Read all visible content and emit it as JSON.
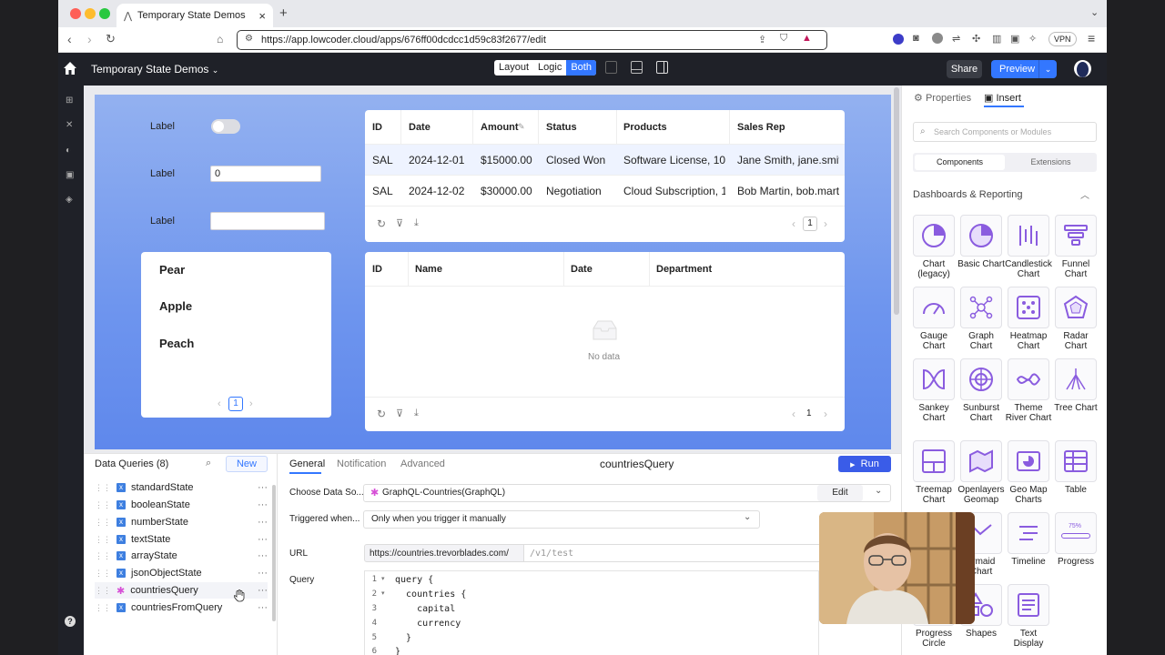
{
  "browser": {
    "tab_title": "Temporary State Demos",
    "url": "https://app.lowcoder.cloud/apps/676ff00dcdcc1d59c83f2677/edit",
    "vpn": "VPN"
  },
  "header": {
    "app_title": "Temporary State Demos",
    "modes": [
      "Layout",
      "Logic",
      "Both"
    ],
    "active_mode": "Both",
    "share": "Share",
    "preview": "Preview"
  },
  "canvas": {
    "form": {
      "label1": "Label",
      "label2": "Label",
      "label3": "Label",
      "input_value": "0"
    },
    "list": {
      "items": [
        "Pear",
        "Apple",
        "Peach"
      ],
      "page": "1"
    },
    "table1": {
      "columns": [
        "ID",
        "Date",
        "Amount",
        "Status",
        "Products",
        "Sales Rep"
      ],
      "rows": [
        [
          "SAL",
          "2024-12-01",
          "$15000.00",
          "Closed Won",
          "Software License, 10",
          "Jane Smith, jane.smit"
        ],
        [
          "SAL",
          "2024-12-02",
          "$30000.00",
          "Negotiation",
          "Cloud Subscription, 1",
          "Bob Martin, bob.mart"
        ]
      ],
      "page": "1"
    },
    "table2": {
      "columns": [
        "ID",
        "Name",
        "Date",
        "Department"
      ],
      "empty": "No data",
      "page": "1"
    }
  },
  "right_panel": {
    "tabs": [
      "Properties",
      "Insert"
    ],
    "search_placeholder": "Search Components or Modules",
    "subtabs": [
      "Components",
      "Extensions"
    ],
    "section": "Dashboards & Reporting",
    "components": [
      "Chart (legacy)",
      "Basic Chart",
      "Candlestick Chart",
      "Funnel Chart",
      "Gauge Chart",
      "Graph Chart",
      "Heatmap Chart",
      "Radar Chart",
      "Sankey Chart",
      "Sunburst Chart",
      "Theme River Chart",
      "Tree Chart",
      "Treemap Chart",
      "Openlayers Geomap",
      "Geo Map Charts",
      "Table",
      "ermaid Chart",
      "Timeline",
      "Progress",
      "Progress Circle",
      "Shapes",
      "Text Display"
    ],
    "progress_badge": "75%"
  },
  "queries": {
    "title": "Data Queries (8)",
    "new": "New",
    "items": [
      "standardState",
      "booleanState",
      "numberState",
      "textState",
      "arrayState",
      "jsonObjectState",
      "countriesQuery",
      "countriesFromQuery"
    ]
  },
  "editor": {
    "tabs": [
      "General",
      "Notification",
      "Advanced"
    ],
    "query_name": "countriesQuery",
    "run": "Run",
    "data_source_label": "Choose Data So...",
    "data_source": "GraphQL-Countries(GraphQL)",
    "edit": "Edit",
    "trigger_label": "Triggered when...",
    "trigger": "Only when you trigger it manually",
    "url_label": "URL",
    "url_base": "https://countries.trevorblades.com/",
    "url_path": "/v1/test",
    "query_label": "Query",
    "code": [
      {
        "n": "1",
        "t": "query {"
      },
      {
        "n": "2",
        "t": "  countries {"
      },
      {
        "n": "3",
        "t": "    capital"
      },
      {
        "n": "4",
        "t": "    currency"
      },
      {
        "n": "5",
        "t": "  }"
      },
      {
        "n": "6",
        "t": "}"
      }
    ]
  }
}
